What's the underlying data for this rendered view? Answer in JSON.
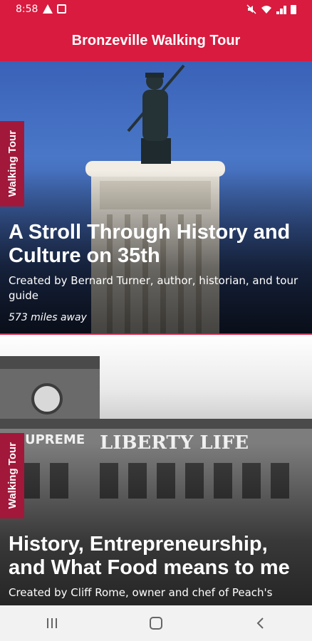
{
  "status_bar": {
    "time": "8:58",
    "left_icons": [
      "alert-icon",
      "notification-box-icon"
    ],
    "right_icons": [
      "mute-icon",
      "wifi-icon",
      "signal-icon",
      "battery-icon"
    ]
  },
  "app_bar": {
    "title": "Bronzeville Walking Tour",
    "color": "#d81b3f"
  },
  "tours": [
    {
      "tag": "Walking Tour",
      "title": "A Stroll Through History and Culture on 35th",
      "subtitle": "Created by Bernard Turner, author, historian, and tour guide",
      "distance": "573 miles away",
      "image": "bronze-soldier-statue-on-monument"
    },
    {
      "tag": "Walking Tour",
      "title": "History, Entrepreneurship, and What Food means to me",
      "subtitle": "Created by Cliff Rome, owner and chef of Peach's",
      "image": "historic-supreme-liberty-life-building",
      "signs": [
        "SUPREME",
        "LIBERTY LIFE"
      ]
    }
  ],
  "nav_bar": {
    "buttons": [
      "recent-apps-icon",
      "home-icon",
      "back-icon"
    ]
  },
  "colors": {
    "accent": "#d81b3f",
    "tag_bg": "#a2183a"
  }
}
